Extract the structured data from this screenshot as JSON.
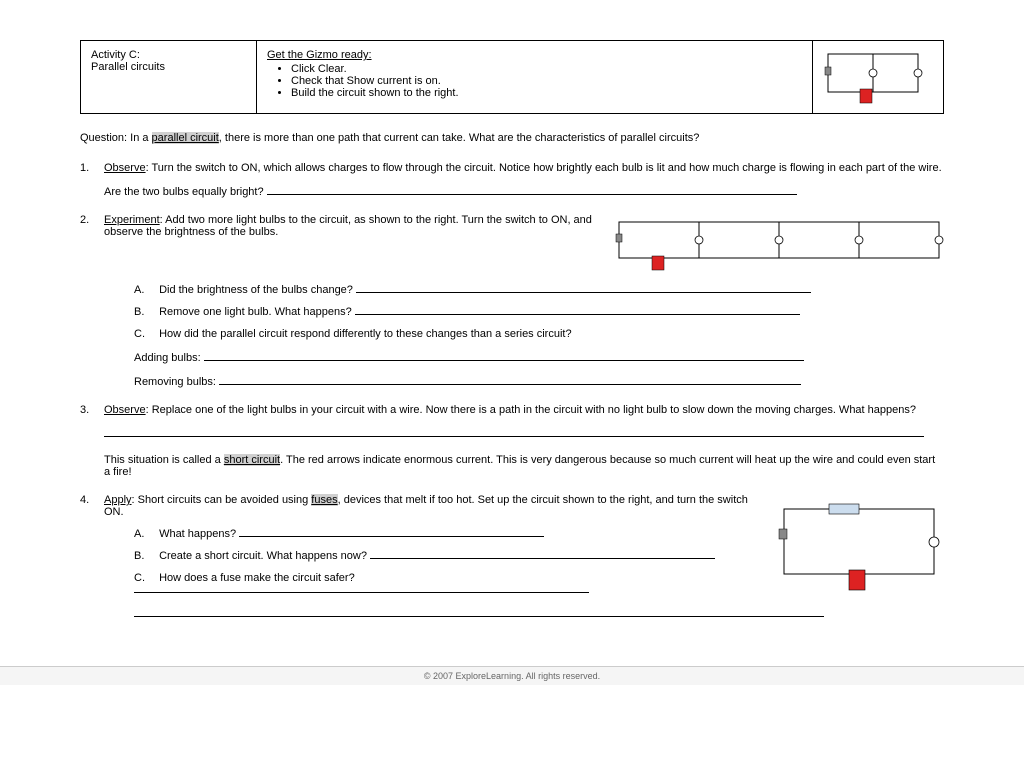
{
  "header": {
    "activity_label": "Activity C:",
    "activity_title": "Parallel circuits",
    "ready_title": "Get the Gizmo ready:",
    "ready_items": [
      "Click Clear.",
      "Check that Show current is on.",
      "Build the circuit shown to the right."
    ]
  },
  "question": {
    "prefix": "Question: In a ",
    "term": "parallel circuit",
    "suffix": ", there is more than one path that current can take. What are the characteristics of parallel circuits?"
  },
  "q1": {
    "num": "1.",
    "lead": "Observe",
    "text": ": Turn the switch to ON, which allows charges to flow through the circuit. Notice how brightly each bulb is lit and how much charge is flowing in each part of the wire.",
    "prompt": "Are the two bulbs equally bright? "
  },
  "q2": {
    "num": "2.",
    "lead": "Experiment",
    "text": ": Add two more light bulbs to the circuit, as shown to the right. Turn the switch to ON, and observe the brightness of the bulbs.",
    "a_label": "A.",
    "a_text": "Did the brightness of the bulbs change? ",
    "b_label": "B.",
    "b_text": "Remove one light bulb. What happens? ",
    "c_label": "C.",
    "c_text": "How did the parallel circuit respond differently to these changes than a series circuit?",
    "adding": "Adding bulbs: ",
    "removing": "Removing bulbs: "
  },
  "q3": {
    "num": "3.",
    "lead": "Observe",
    "text": ": Replace one of the light bulbs in your circuit with a wire. Now there is a path in the circuit with no light bulb to slow down the moving charges. What happens?",
    "note_pre": "This situation is called a ",
    "note_term": "short circuit",
    "note_post": ". The red arrows indicate enormous current. This is very dangerous because so much current will heat up the wire and could even start a fire!"
  },
  "q4": {
    "num": "4.",
    "lead": "Apply",
    "text_pre": ": Short circuits can be avoided using ",
    "term": "fuses",
    "text_post": ", devices that melt if too hot. Set up the circuit shown to the right, and turn the switch ON.",
    "a_label": "A.",
    "a_text": "What happens? ",
    "b_label": "B.",
    "b_text": "Create a short circuit. What happens now? ",
    "c_label": "C.",
    "c_text": "How does a fuse make the circuit safer? "
  },
  "footer": "© 2007 ExploreLearning. All rights reserved."
}
